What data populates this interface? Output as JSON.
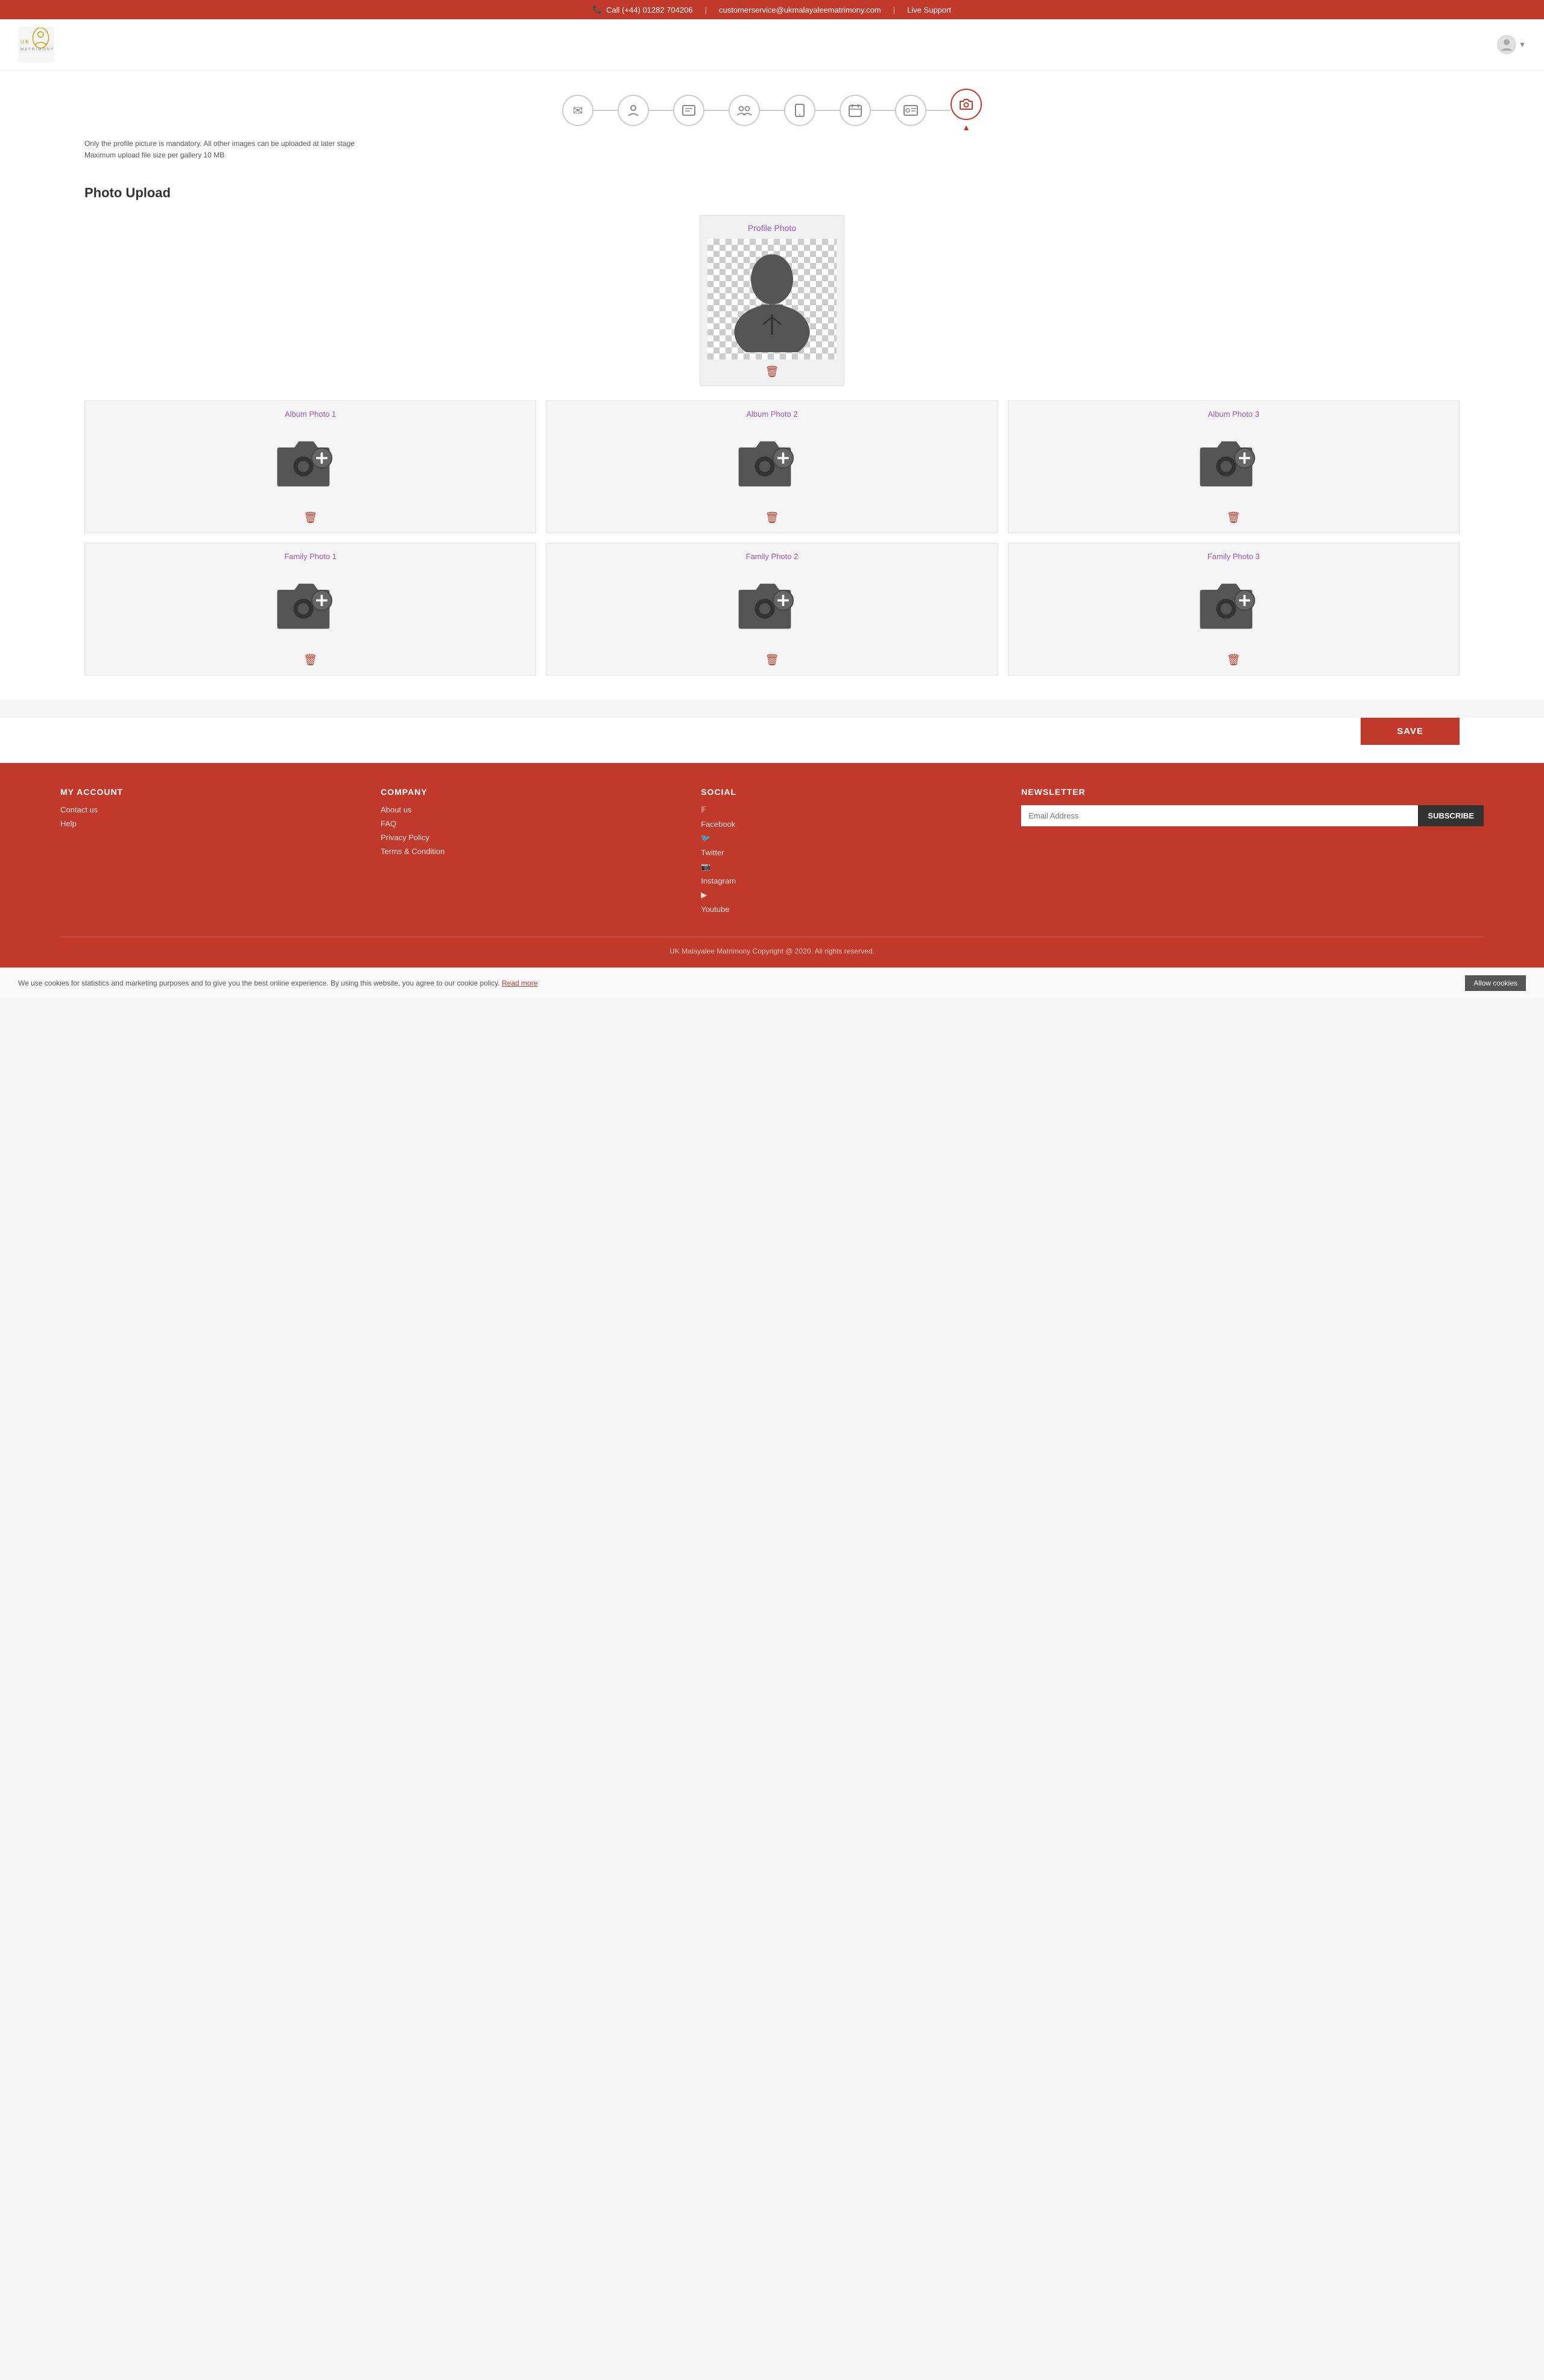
{
  "topbar": {
    "phone": "Call (+44) 01282 704206",
    "email": "customerservice@ukmalayaleematrimony.com",
    "support": "Live Support"
  },
  "header": {
    "logo_text": "U.K MATRIMONY",
    "user_icon": "user"
  },
  "steps": [
    {
      "id": 1,
      "icon": "✉",
      "label": "email",
      "active": false
    },
    {
      "id": 2,
      "icon": "👤",
      "label": "person",
      "active": false
    },
    {
      "id": 3,
      "icon": "📋",
      "label": "contact-card",
      "active": false
    },
    {
      "id": 4,
      "icon": "👥",
      "label": "group",
      "active": false
    },
    {
      "id": 5,
      "icon": "📞",
      "label": "phone",
      "active": false
    },
    {
      "id": 6,
      "icon": "📅",
      "label": "calendar",
      "active": false
    },
    {
      "id": 7,
      "icon": "🪪",
      "label": "id-card",
      "active": false
    },
    {
      "id": 8,
      "icon": "📷",
      "label": "camera",
      "active": true
    }
  ],
  "info": {
    "line1": "Only the profile picture is mandatory. All other images can be uploaded at later stage",
    "line2": "Maximum upload file size per gallery 10 MB"
  },
  "page_title": "Photo Upload",
  "profile_photo": {
    "label": "Profile Photo"
  },
  "album_photos": [
    {
      "label": "Album Photo 1"
    },
    {
      "label": "Album Photo 2"
    },
    {
      "label": "Album Photo 3"
    }
  ],
  "family_photos": [
    {
      "label": "Family Photo 1"
    },
    {
      "label": "Family Photo 2"
    },
    {
      "label": "Family Photo 3"
    }
  ],
  "save_button": "SAVE",
  "footer": {
    "my_account": {
      "title": "MY ACCOUNT",
      "links": [
        "Contact us",
        "Help"
      ]
    },
    "company": {
      "title": "COMPANY",
      "links": [
        "About us",
        "FAQ",
        "Privacy Policy",
        "Terms & Condition"
      ]
    },
    "social": {
      "title": "SOCIAL",
      "links": [
        "Facebook",
        "Twitter",
        "Instagram",
        "Youtube"
      ]
    },
    "newsletter": {
      "title": "NEWSLETTER",
      "placeholder": "Email Address",
      "button": "SUBSCRIBE"
    },
    "copyright": "UK Malayalee Matrimony Copyright @ 2020. All rights reserved."
  },
  "cookie": {
    "text": "We use cookies for statistics and marketing purposes and to give you the best online experience. By using this website, you agree to our cookie policy.",
    "read_more": "Read more",
    "allow": "Allow cookies"
  }
}
